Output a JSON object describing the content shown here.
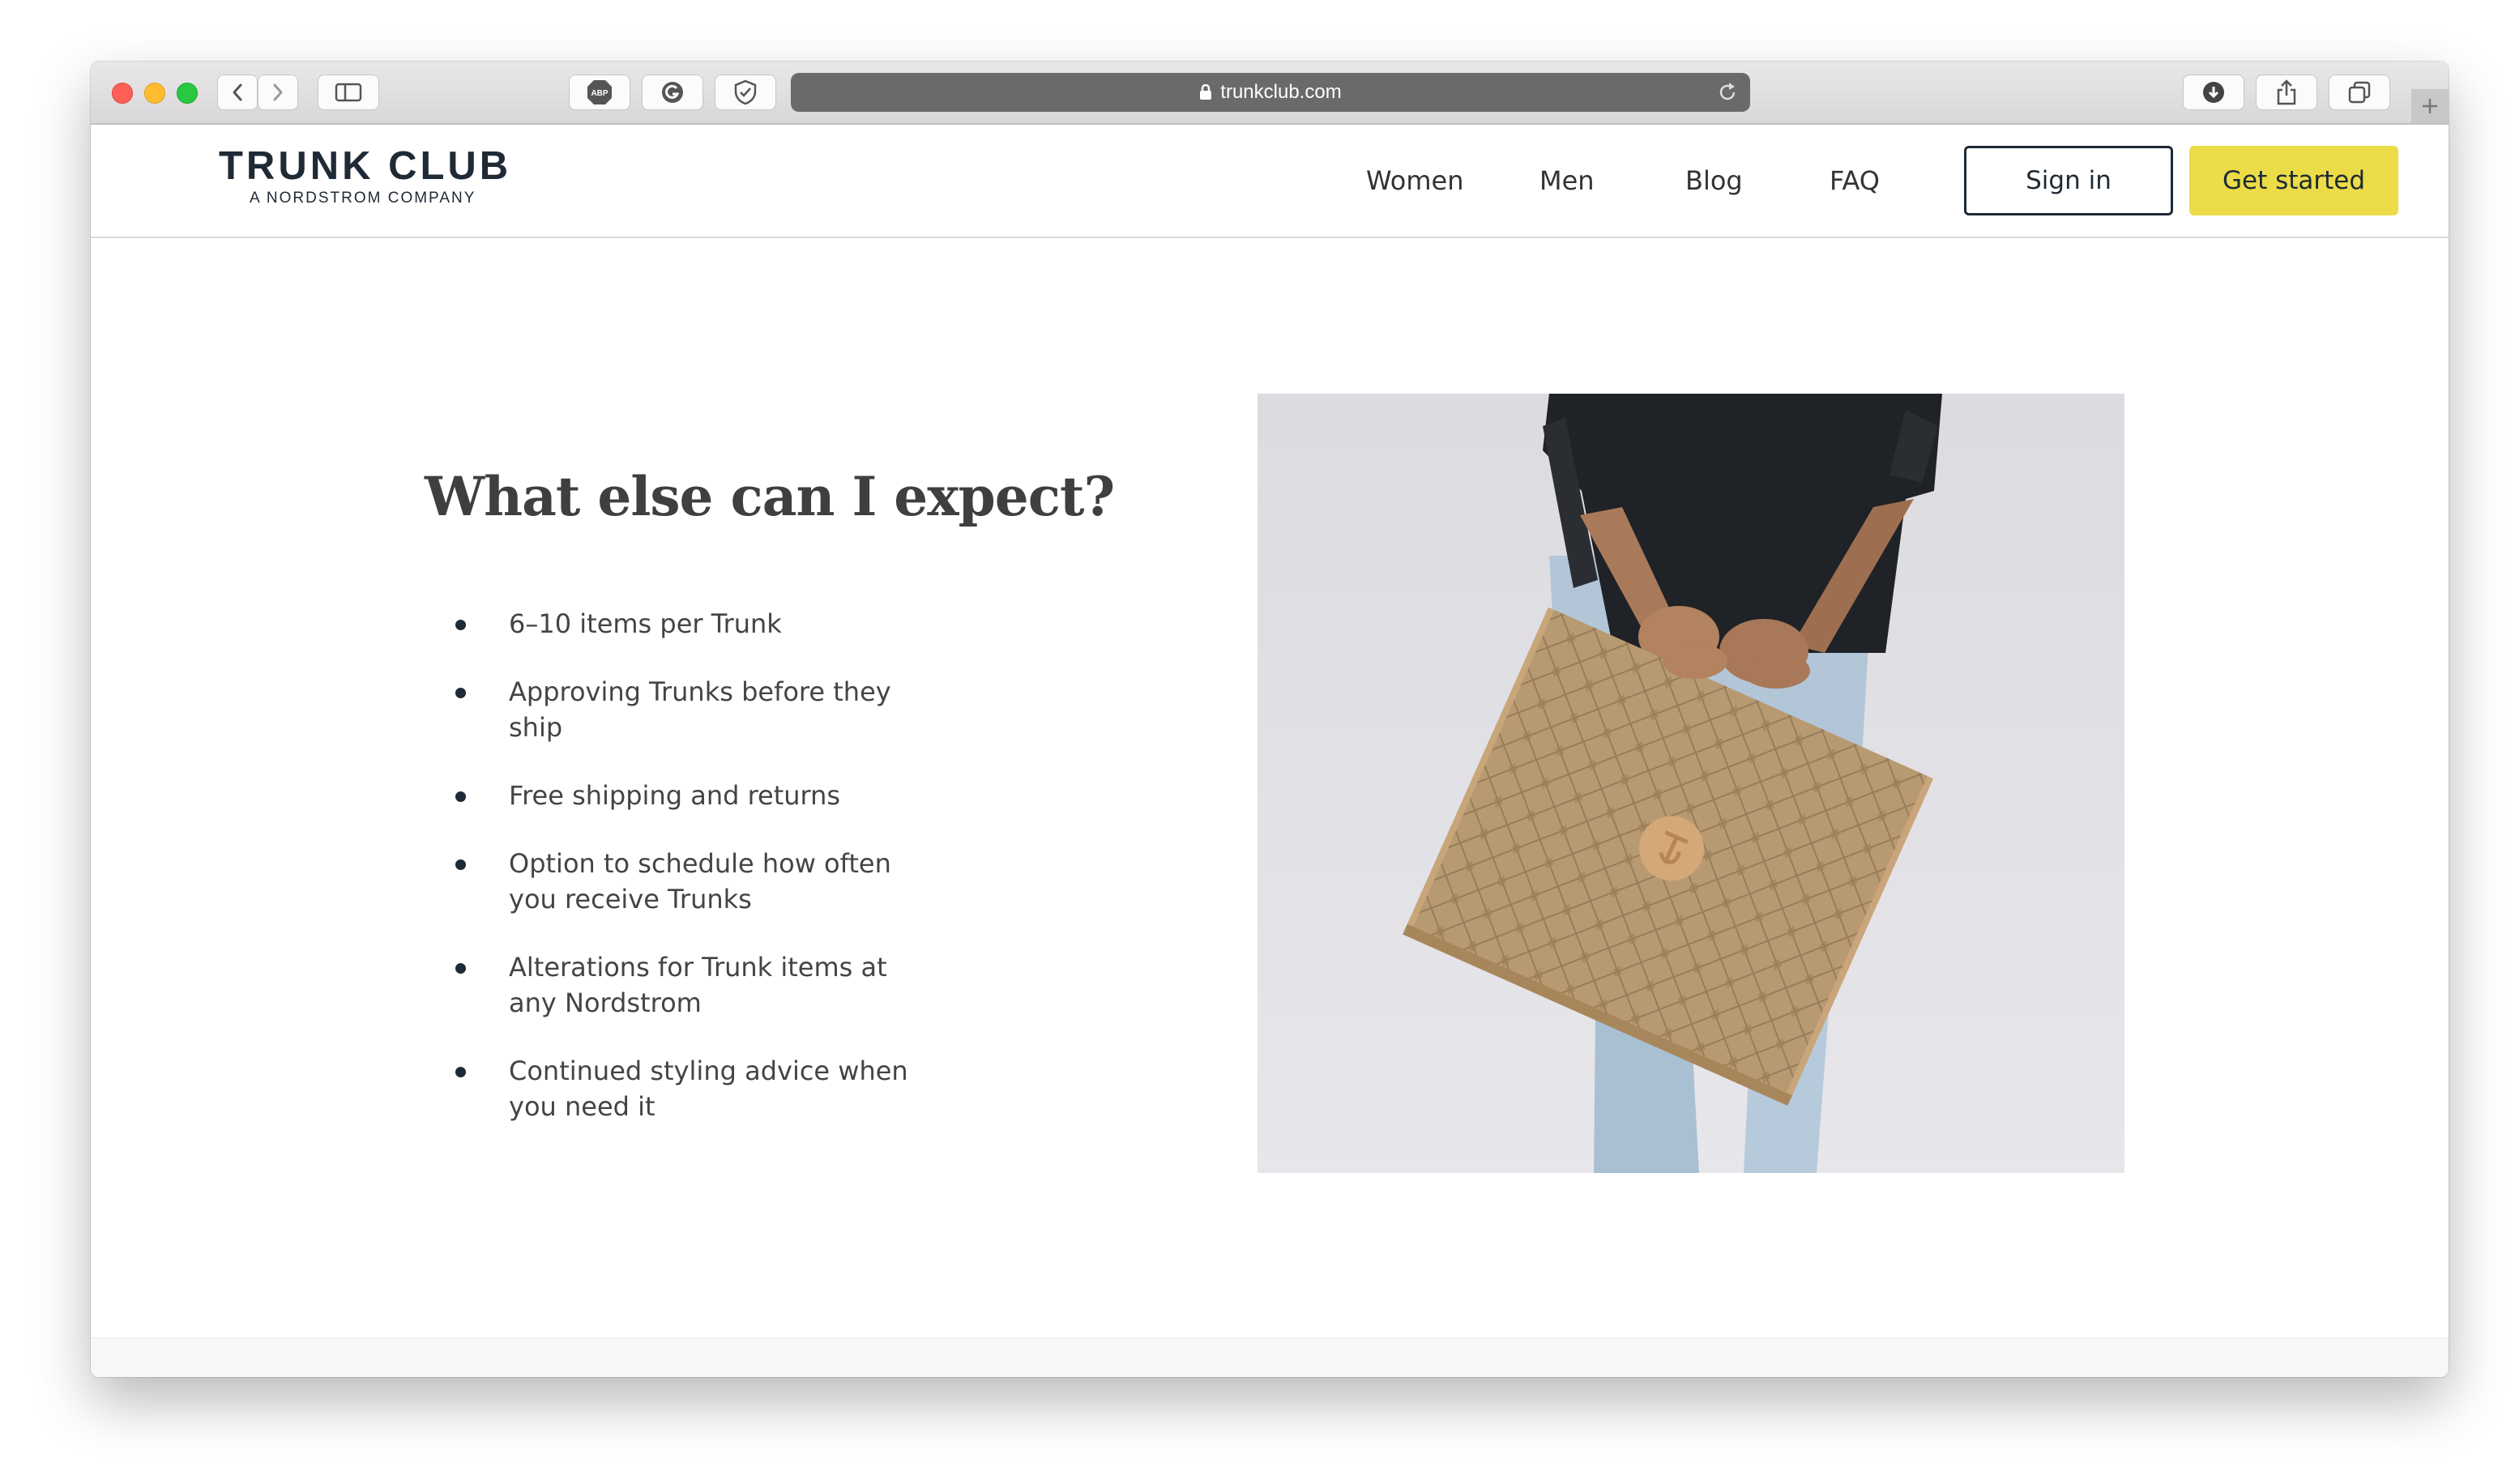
{
  "browser": {
    "url": "trunkclub.com",
    "adblock_label": "ABP"
  },
  "header": {
    "logo_main": "TRUNK CLUB",
    "logo_sub": "A NORDSTROM COMPANY",
    "nav": {
      "women": "Women",
      "men": "Men",
      "blog": "Blog",
      "faq": "FAQ"
    },
    "signin_label": "Sign in",
    "getstarted_label": "Get started"
  },
  "main": {
    "heading": "What else can I expect?",
    "features": [
      "6–10 items per Trunk",
      "Approving Trunks before they ship",
      "Free shipping and returns",
      "Option to schedule how often you receive Trunks",
      "Alterations for Trunk items at any Nordstrom",
      "Continued styling advice when you need it"
    ]
  },
  "colors": {
    "brand_navy": "#1e2a35",
    "cta_yellow": "#ebdc48",
    "box_kraft": "#b89a72"
  }
}
